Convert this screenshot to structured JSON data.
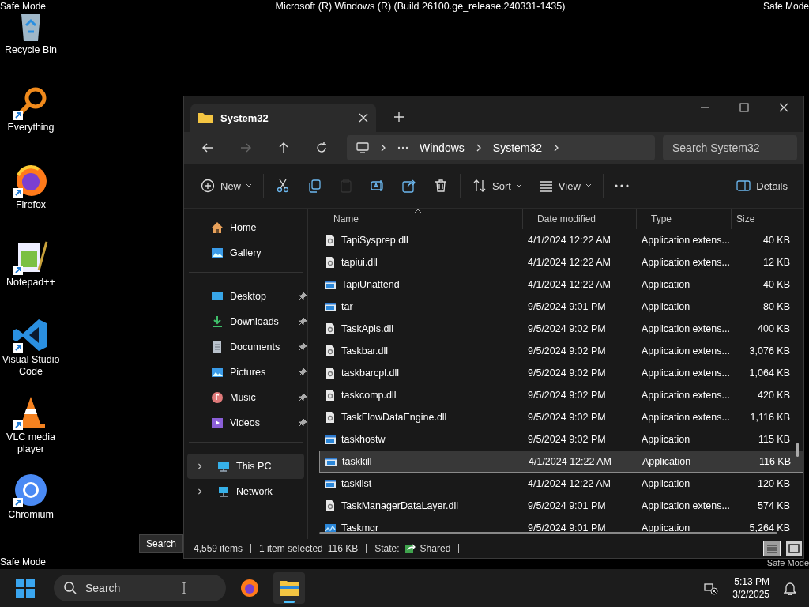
{
  "desktop": {
    "title": "Microsoft (R) Windows (R) (Build 26100.ge_release.240331-1435)",
    "watermarks": [
      "Safe Mode",
      "Safe Mode",
      "Safe Mode",
      "Safe Mode"
    ]
  },
  "desktop_icons": [
    {
      "label": "Recycle Bin",
      "kind": "recycle",
      "shortcut": false
    },
    {
      "label": "Everything",
      "kind": "everything",
      "shortcut": true
    },
    {
      "label": "Firefox",
      "kind": "firefox",
      "shortcut": true
    },
    {
      "label": "Notepad++",
      "kind": "notepad",
      "shortcut": true
    },
    {
      "label": "Visual Studio Code",
      "kind": "vscode",
      "shortcut": true
    },
    {
      "label": "VLC media player",
      "kind": "vlc",
      "shortcut": true
    },
    {
      "label": "Chromium",
      "kind": "chromium",
      "shortcut": true
    }
  ],
  "explorer": {
    "tabs": [
      {
        "label": "System32",
        "selected": true
      }
    ],
    "nav": [
      {
        "kind": "back",
        "disabled": false
      },
      {
        "kind": "forward",
        "disabled": true
      },
      {
        "kind": "up",
        "disabled": false
      },
      {
        "kind": "refresh",
        "disabled": false
      }
    ],
    "breadcrumb": [
      "Windows",
      "System32"
    ],
    "search": {
      "placeholder": "Search System32"
    },
    "commands": [
      {
        "kind": "new",
        "label": "New",
        "disabled": false
      },
      {
        "kind": "cut",
        "disabled": false
      },
      {
        "kind": "copy",
        "disabled": false
      },
      {
        "kind": "paste",
        "disabled": true
      },
      {
        "kind": "rename",
        "disabled": false
      },
      {
        "kind": "share",
        "disabled": false
      },
      {
        "kind": "delete",
        "disabled": false
      },
      {
        "kind": "sort",
        "label": "Sort",
        "disabled": false
      },
      {
        "kind": "view",
        "label": "View",
        "disabled": false
      },
      {
        "kind": "more",
        "disabled": false
      },
      {
        "kind": "details",
        "label": "Details",
        "disabled": false
      }
    ],
    "sidebar": {
      "top": [
        {
          "label": "Home",
          "kind": "home"
        },
        {
          "label": "Gallery",
          "kind": "gallery"
        }
      ],
      "quick": [
        {
          "label": "Desktop",
          "kind": "desktop",
          "pinned": true
        },
        {
          "label": "Downloads",
          "kind": "downloads",
          "pinned": true
        },
        {
          "label": "Documents",
          "kind": "documents",
          "pinned": true
        },
        {
          "label": "Pictures",
          "kind": "pictures",
          "pinned": true
        },
        {
          "label": "Music",
          "kind": "music",
          "pinned": true
        },
        {
          "label": "Videos",
          "kind": "videos",
          "pinned": true
        }
      ],
      "tree": [
        {
          "label": "This PC",
          "kind": "pc",
          "selected": true,
          "expanded": false
        },
        {
          "label": "Network",
          "kind": "network",
          "selected": false,
          "expanded": false
        }
      ]
    },
    "columns": [
      {
        "label": "Name",
        "sorted": true
      },
      {
        "label": "Date modified",
        "sorted": false
      },
      {
        "label": "Type",
        "sorted": false
      },
      {
        "label": "Size",
        "sorted": false
      }
    ],
    "rows": [
      {
        "name": "TapiSysprep.dll",
        "kind": "dll",
        "date": "4/1/2024 12:22 AM",
        "type": "Application extens...",
        "size": "40 KB",
        "selected": false
      },
      {
        "name": "tapiui.dll",
        "kind": "dll",
        "date": "4/1/2024 12:22 AM",
        "type": "Application extens...",
        "size": "12 KB",
        "selected": false
      },
      {
        "name": "TapiUnattend",
        "kind": "app",
        "date": "4/1/2024 12:22 AM",
        "type": "Application",
        "size": "40 KB",
        "selected": false
      },
      {
        "name": "tar",
        "kind": "app",
        "date": "9/5/2024 9:01 PM",
        "type": "Application",
        "size": "80 KB",
        "selected": false
      },
      {
        "name": "TaskApis.dll",
        "kind": "dll",
        "date": "9/5/2024 9:02 PM",
        "type": "Application extens...",
        "size": "400 KB",
        "selected": false
      },
      {
        "name": "Taskbar.dll",
        "kind": "dll",
        "date": "9/5/2024 9:02 PM",
        "type": "Application extens...",
        "size": "3,076 KB",
        "selected": false
      },
      {
        "name": "taskbarcpl.dll",
        "kind": "dll",
        "date": "9/5/2024 9:02 PM",
        "type": "Application extens...",
        "size": "1,064 KB",
        "selected": false
      },
      {
        "name": "taskcomp.dll",
        "kind": "dll",
        "date": "9/5/2024 9:02 PM",
        "type": "Application extens...",
        "size": "420 KB",
        "selected": false
      },
      {
        "name": "TaskFlowDataEngine.dll",
        "kind": "dll",
        "date": "9/5/2024 9:02 PM",
        "type": "Application extens...",
        "size": "1,116 KB",
        "selected": false
      },
      {
        "name": "taskhostw",
        "kind": "app",
        "date": "9/5/2024 9:02 PM",
        "type": "Application",
        "size": "115 KB",
        "selected": false
      },
      {
        "name": "taskkill",
        "kind": "app",
        "date": "4/1/2024 12:22 AM",
        "type": "Application",
        "size": "116 KB",
        "selected": true
      },
      {
        "name": "tasklist",
        "kind": "app",
        "date": "4/1/2024 12:22 AM",
        "type": "Application",
        "size": "120 KB",
        "selected": false
      },
      {
        "name": "TaskManagerDataLayer.dll",
        "kind": "dll",
        "date": "9/5/2024 9:01 PM",
        "type": "Application extens...",
        "size": "574 KB",
        "selected": false
      },
      {
        "name": "Taskmgr",
        "kind": "taskmgr",
        "date": "9/5/2024 9:01 PM",
        "type": "Application",
        "size": "5,264 KB",
        "selected": false
      }
    ],
    "status": {
      "items": "4,559 items",
      "selection": "1 item selected",
      "size": "116 KB",
      "state_label": "State:",
      "state": "Shared"
    },
    "views": [
      {
        "kind": "details",
        "selected": true
      },
      {
        "kind": "tiles",
        "selected": false
      }
    ]
  },
  "tooltip": "Search",
  "taskbar": {
    "search": {
      "placeholder": "Search"
    },
    "apps": [
      {
        "kind": "firefox",
        "active": false
      },
      {
        "kind": "explorer",
        "active": true
      }
    ],
    "time": "5:13 PM",
    "date": "3/2/2025"
  }
}
